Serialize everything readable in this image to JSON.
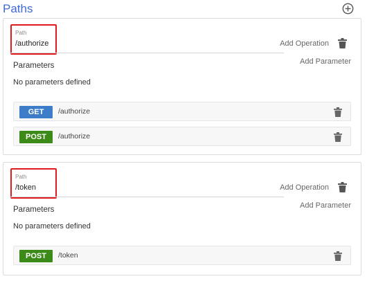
{
  "header": {
    "title": "Paths",
    "add_icon": "plus-circle-icon"
  },
  "labels": {
    "path_label": "Path",
    "add_operation": "Add Operation",
    "add_parameter": "Add Parameter",
    "parameters": "Parameters",
    "no_parameters": "No parameters defined"
  },
  "colors": {
    "title": "#3f6ad8",
    "get_method": "#3d7cc9",
    "post_method": "#3c8a17",
    "highlight": "#e0191c"
  },
  "paths": [
    {
      "path": "/authorize",
      "operations": [
        {
          "method": "GET",
          "path": "/authorize"
        },
        {
          "method": "POST",
          "path": "/authorize"
        }
      ]
    },
    {
      "path": "/token",
      "operations": [
        {
          "method": "POST",
          "path": "/token"
        }
      ]
    }
  ]
}
